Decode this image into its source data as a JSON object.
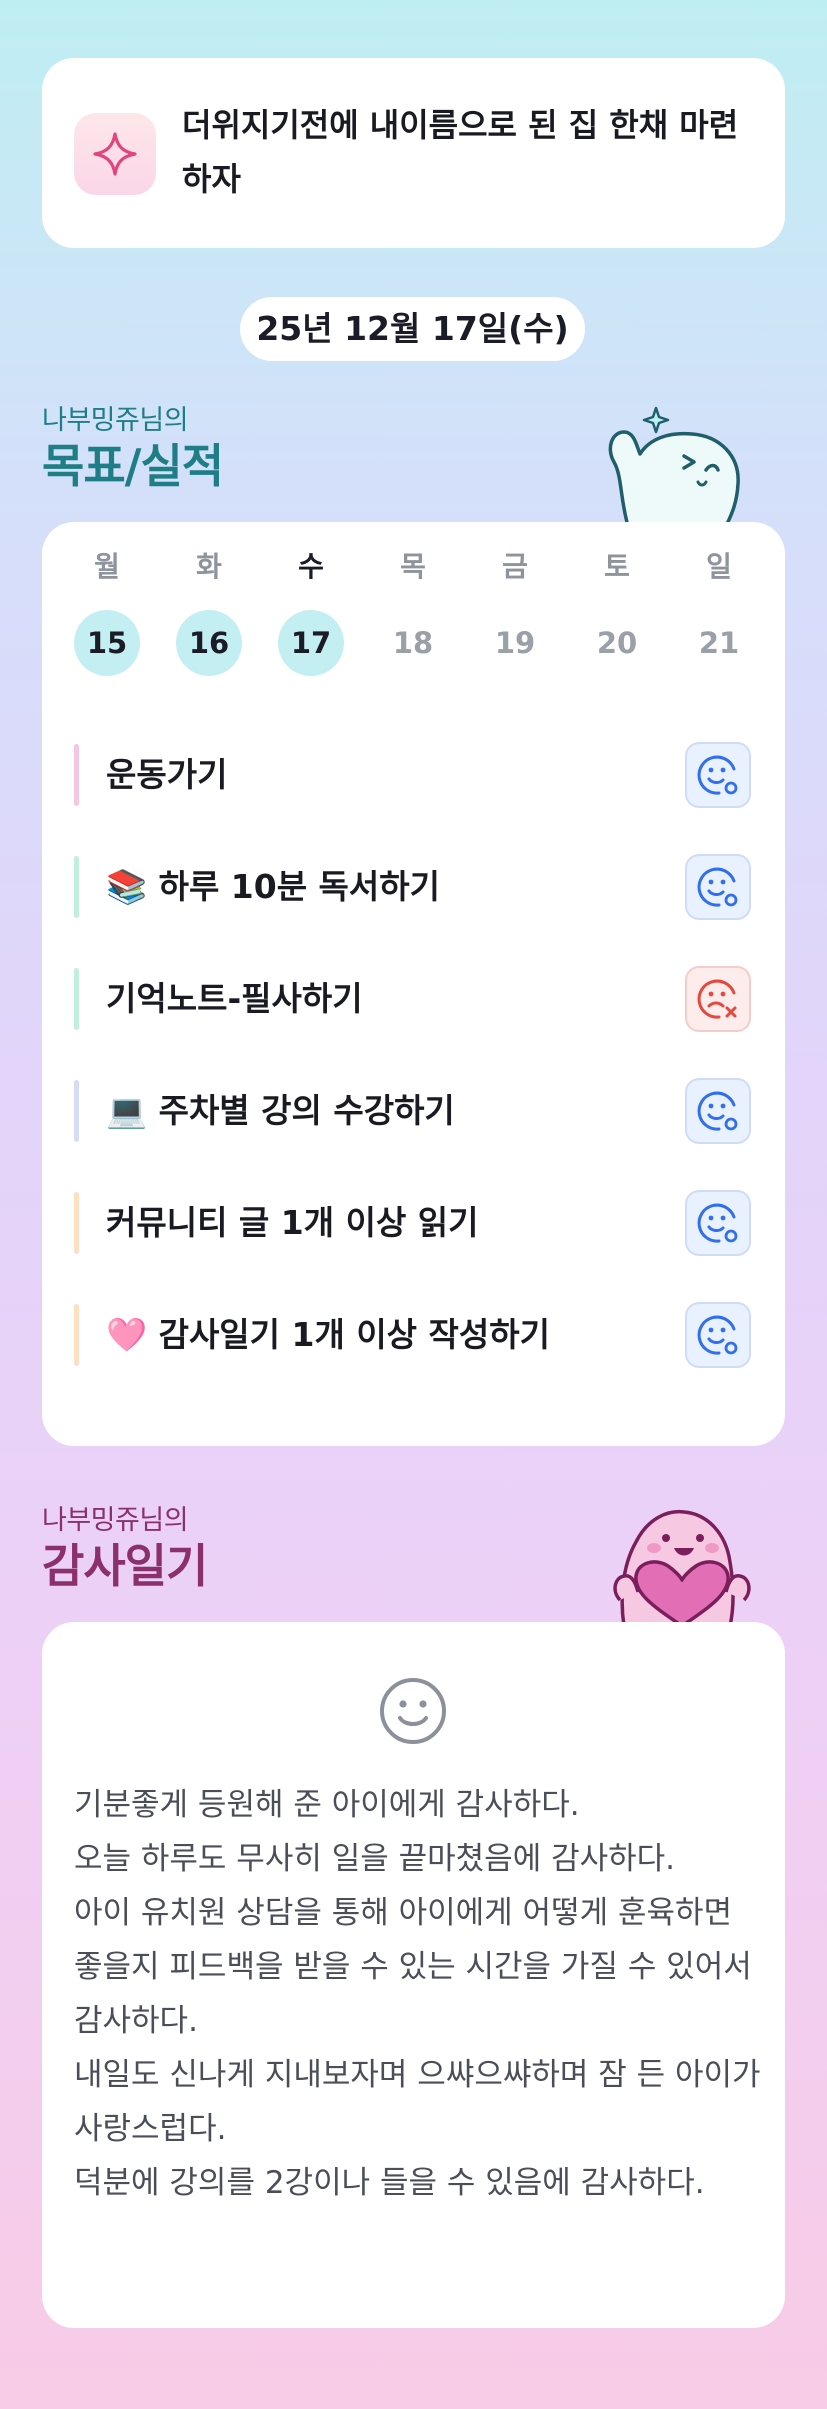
{
  "goal": {
    "icon": "sparkle-icon",
    "text": "더위지기전에 내이름으로 된 집 한채 마련하자"
  },
  "date_label": "25년 12월 17일(수)",
  "goals_section": {
    "subtitle": "나부밍쥬님의",
    "title": "목표/실적",
    "mascot": "waving-bear-mascot"
  },
  "week": [
    {
      "day": "월",
      "date": "15",
      "state": "done"
    },
    {
      "day": "화",
      "date": "16",
      "state": "done"
    },
    {
      "day": "수",
      "date": "17",
      "state": "today"
    },
    {
      "day": "목",
      "date": "18",
      "state": "future"
    },
    {
      "day": "금",
      "date": "19",
      "state": "future"
    },
    {
      "day": "토",
      "date": "20",
      "state": "future"
    },
    {
      "day": "일",
      "date": "21",
      "state": "future"
    }
  ],
  "tasks": [
    {
      "label": "운동가기",
      "bar_color": "#f5c6e3",
      "status": "complete",
      "icon": "smile-check-icon"
    },
    {
      "label": "📚 하루 10분 독서하기",
      "bar_color": "#bff0dd",
      "status": "complete",
      "icon": "smile-check-icon"
    },
    {
      "label": "기억노트-필사하기",
      "bar_color": "#bff0dd",
      "status": "failed",
      "icon": "sad-x-icon"
    },
    {
      "label": "💻 주차별 강의 수강하기",
      "bar_color": "#d5ddf6",
      "status": "complete",
      "icon": "smile-check-icon"
    },
    {
      "label": "커뮤니티 글 1개 이상 읽기",
      "bar_color": "#fde0c2",
      "status": "complete",
      "icon": "smile-check-icon"
    },
    {
      "label": "🩷 감사일기 1개 이상 작성하기",
      "bar_color": "#fde0c2",
      "status": "complete",
      "icon": "smile-check-icon"
    }
  ],
  "status_colors": {
    "complete": "#2f6ff0",
    "failed": "#e5483c"
  },
  "diary_section": {
    "subtitle": "나부밍쥬님의",
    "title": "감사일기",
    "mascot": "heart-bear-mascot"
  },
  "diary": {
    "mood_icon": "smile-face-icon",
    "text": "기분좋게 등원해 준 아이에게 감사하다.\n오늘 하루도 무사히 일을 끝마쳤음에 감사하다.\n아이 유치원 상담을 통해 아이에게 어떻게 훈육하면 좋을지 피드백을 받을 수 있는 시간을 가질 수 있어서 감사하다.\n내일도 신나게 지내보자며 으쌰으쌰하며 잠 든 아이가 사랑스럽다.\n덕분에 강의를 2강이나 들을 수 있음에 감사하다."
  }
}
